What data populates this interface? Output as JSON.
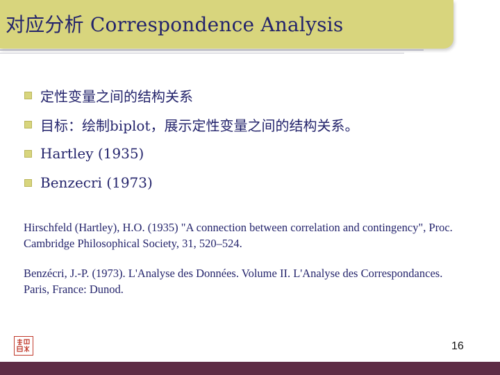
{
  "slide": {
    "title": "对应分析 Correspondence Analysis",
    "bullets": [
      "定性变量之间的结构关系",
      "目标：绘制biplot，展示定性变量之间的结构关系。",
      "Hartley (1935)",
      "Benzecri (1973)"
    ],
    "references": [
      "Hirschfeld (Hartley), H.O. (1935) \"A connection between correlation and contingency\", Proc. Cambridge Philosophical Society, 31, 520–524.",
      "Benzécri, J.-P. (1973). L'Analyse des Données. Volume II. L'Analyse des Correspondances. Paris, France: Dunod."
    ],
    "page_number": "16"
  },
  "colors": {
    "title_bar": "#d8d57d",
    "text": "#23236b",
    "footer_bar": "#5e2c45",
    "seal": "#c0392b"
  },
  "icons": {
    "bullet": "square-bullet-icon",
    "seal": "seal-stamp-icon"
  }
}
